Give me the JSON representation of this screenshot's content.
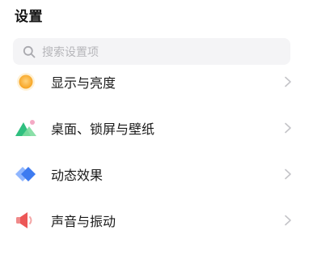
{
  "header": {
    "title": "设置"
  },
  "search": {
    "placeholder": "搜索设置项",
    "icon": "search-icon"
  },
  "settings_items": [
    {
      "label": "显示与亮度",
      "icon": "brightness-sun-icon",
      "color": "#f6a623"
    },
    {
      "label": "桌面、锁屏与壁纸",
      "icon": "wallpaper-landscape-icon",
      "color": "#36c28a"
    },
    {
      "label": "动态效果",
      "icon": "motion-effects-icon",
      "color": "#3d7bf0"
    },
    {
      "label": "声音与振动",
      "icon": "speaker-sound-icon",
      "color": "#ee5a5a"
    }
  ],
  "colors": {
    "chevron": "#c4c4c8",
    "search_background": "#f4f4f6",
    "placeholder_text": "#b6b6ba"
  }
}
